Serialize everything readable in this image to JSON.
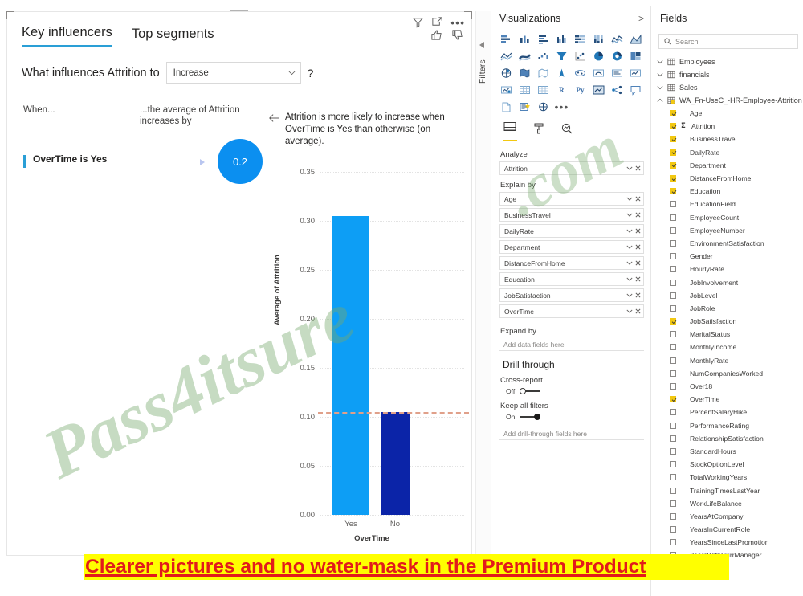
{
  "visual": {
    "tabs": [
      {
        "label": "Key influencers",
        "active": true
      },
      {
        "label": "Top segments",
        "active": false
      }
    ],
    "question_prefix": "What influences Attrition to",
    "question_value": "Increase",
    "help_glyph": "?",
    "columns": {
      "when": "When...",
      "average": "...the average of Attrition increases by"
    },
    "influencer": {
      "label": "OverTime is Yes",
      "value": "0.2"
    },
    "detail_text": "Attrition is more likely to increase when OverTime is Yes than otherwise (on average)."
  },
  "chart_data": {
    "type": "bar",
    "title": "",
    "categories": [
      "Yes",
      "No"
    ],
    "values": [
      0.305,
      0.105
    ],
    "xlabel": "OverTime",
    "ylabel": "Average of Attrition",
    "ylim": [
      0.0,
      0.375
    ],
    "yticks": [
      "0.35",
      "0.30",
      "0.25",
      "0.20",
      "0.15",
      "0.10",
      "0.05",
      "0.00"
    ],
    "ytick_values": [
      0.35,
      0.3,
      0.25,
      0.2,
      0.15,
      0.1,
      0.05,
      0.0
    ],
    "grid": true,
    "legend": "none",
    "colors": [
      "#0d9ef5",
      "#0b24a8"
    ],
    "reference_line": {
      "value": 0.105,
      "color": "#e0a08a",
      "style": "dashed"
    }
  },
  "filters_rail": {
    "label": "Filters"
  },
  "visualizations": {
    "title": "Visualizations",
    "collapse_glyph": ">",
    "analyze_label": "Analyze",
    "analyze_field": "Attrition",
    "explain_by_label": "Explain by",
    "explain_by": [
      "Age",
      "BusinessTravel",
      "DailyRate",
      "Department",
      "DistanceFromHome",
      "Education",
      "JobSatisfaction",
      "OverTime"
    ],
    "expand_by_label": "Expand by",
    "expand_by_placeholder": "Add data fields here",
    "drill_through_title": "Drill through",
    "cross_report_label": "Cross-report",
    "cross_report_state": "Off",
    "keep_filters_label": "Keep all filters",
    "keep_filters_state": "On",
    "drill_placeholder": "Add drill-through fields here",
    "pane_tabs": [
      "fields-tab",
      "format-tab",
      "analytics-tab"
    ]
  },
  "fields": {
    "title": "Fields",
    "collapse_glyph": "<",
    "search_placeholder": "Search",
    "tables": [
      {
        "name": "Employees",
        "expanded": false
      },
      {
        "name": "financials",
        "expanded": false
      },
      {
        "name": "Sales",
        "expanded": false
      },
      {
        "name": "WA_Fn-UseC_-HR-Employee-Attrition",
        "expanded": true
      }
    ],
    "columns": [
      {
        "name": "Age",
        "checked": true,
        "measure": false
      },
      {
        "name": "Attrition",
        "checked": true,
        "measure": true
      },
      {
        "name": "BusinessTravel",
        "checked": true,
        "measure": false
      },
      {
        "name": "DailyRate",
        "checked": true,
        "measure": false
      },
      {
        "name": "Department",
        "checked": true,
        "measure": false
      },
      {
        "name": "DistanceFromHome",
        "checked": true,
        "measure": false
      },
      {
        "name": "Education",
        "checked": true,
        "measure": false
      },
      {
        "name": "EducationField",
        "checked": false,
        "measure": false
      },
      {
        "name": "EmployeeCount",
        "checked": false,
        "measure": false
      },
      {
        "name": "EmployeeNumber",
        "checked": false,
        "measure": false
      },
      {
        "name": "EnvironmentSatisfaction",
        "checked": false,
        "measure": false
      },
      {
        "name": "Gender",
        "checked": false,
        "measure": false
      },
      {
        "name": "HourlyRate",
        "checked": false,
        "measure": false
      },
      {
        "name": "JobInvolvement",
        "checked": false,
        "measure": false
      },
      {
        "name": "JobLevel",
        "checked": false,
        "measure": false
      },
      {
        "name": "JobRole",
        "checked": false,
        "measure": false
      },
      {
        "name": "JobSatisfaction",
        "checked": true,
        "measure": false
      },
      {
        "name": "MaritalStatus",
        "checked": false,
        "measure": false
      },
      {
        "name": "MonthlyIncome",
        "checked": false,
        "measure": false
      },
      {
        "name": "MonthlyRate",
        "checked": false,
        "measure": false
      },
      {
        "name": "NumCompaniesWorked",
        "checked": false,
        "measure": false
      },
      {
        "name": "Over18",
        "checked": false,
        "measure": false
      },
      {
        "name": "OverTime",
        "checked": true,
        "measure": false
      },
      {
        "name": "PercentSalaryHike",
        "checked": false,
        "measure": false
      },
      {
        "name": "PerformanceRating",
        "checked": false,
        "measure": false
      },
      {
        "name": "RelationshipSatisfaction",
        "checked": false,
        "measure": false
      },
      {
        "name": "StandardHours",
        "checked": false,
        "measure": false
      },
      {
        "name": "StockOptionLevel",
        "checked": false,
        "measure": false
      },
      {
        "name": "TotalWorkingYears",
        "checked": false,
        "measure": false
      },
      {
        "name": "TrainingTimesLastYear",
        "checked": false,
        "measure": false
      },
      {
        "name": "WorkLifeBalance",
        "checked": false,
        "measure": false
      },
      {
        "name": "YearsAtCompany",
        "checked": false,
        "measure": false
      },
      {
        "name": "YearsInCurrentRole",
        "checked": false,
        "measure": false
      },
      {
        "name": "YearsSinceLastPromotion",
        "checked": false,
        "measure": false
      },
      {
        "name": "YearsWithCurrManager",
        "checked": false,
        "measure": false
      }
    ]
  },
  "watermarks": {
    "main": "Pass4itsure",
    "secondary": ".com",
    "banner": "Clearer pictures and no water-mask in the Premium Product"
  }
}
